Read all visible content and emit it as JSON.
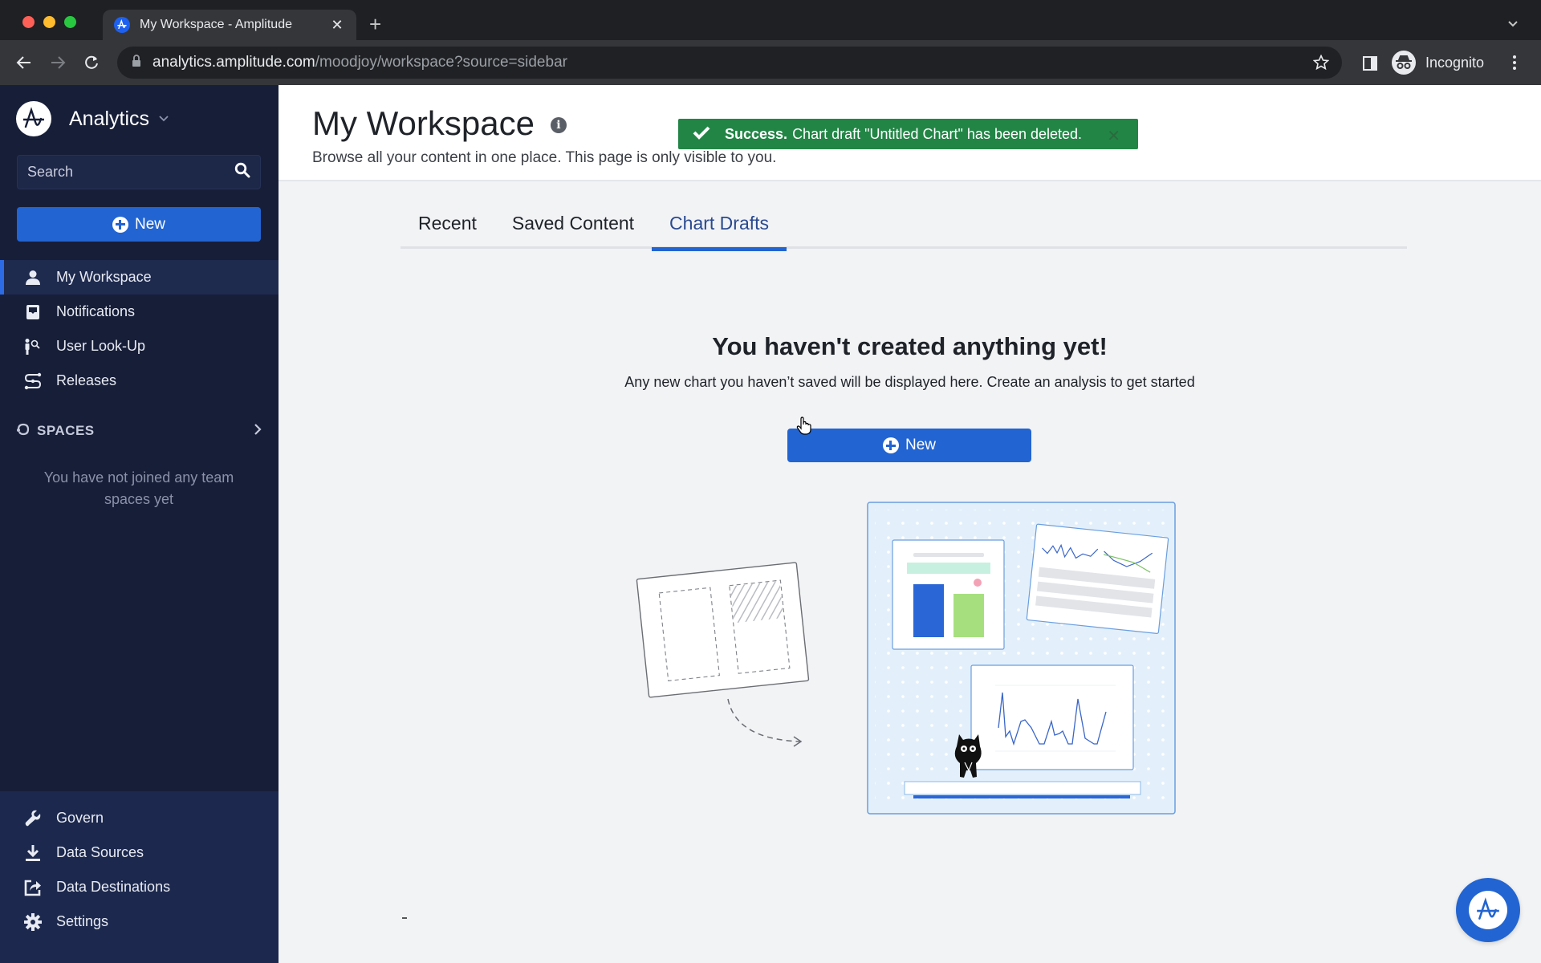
{
  "browser": {
    "tab_title": "My Workspace - Amplitude",
    "url_host": "analytics.amplitude.com",
    "url_path": "/moodjoy/workspace?source=sidebar",
    "profile_label": "Incognito"
  },
  "sidebar": {
    "product_name": "Analytics",
    "search_placeholder": "Search",
    "new_button_label": "New",
    "nav_items": [
      {
        "label": "My Workspace",
        "icon": "person-icon",
        "active": true
      },
      {
        "label": "Notifications",
        "icon": "inbox-icon",
        "active": false
      },
      {
        "label": "User Look-Up",
        "icon": "user-search-icon",
        "active": false
      },
      {
        "label": "Releases",
        "icon": "releases-icon",
        "active": false
      }
    ],
    "spaces": {
      "heading": "SPACES",
      "empty_text": "You have not joined any team spaces yet"
    },
    "bottom_items": [
      {
        "label": "Govern",
        "icon": "wrench-icon"
      },
      {
        "label": "Data Sources",
        "icon": "download-icon"
      },
      {
        "label": "Data Destinations",
        "icon": "share-icon"
      },
      {
        "label": "Settings",
        "icon": "gear-icon"
      }
    ]
  },
  "header": {
    "title": "My Workspace",
    "subtitle": "Browse all your content in one place. This page is only visible to you."
  },
  "toast": {
    "status": "Success.",
    "message": "Chart draft \"Untitled Chart\" has been deleted.",
    "color": "#228546"
  },
  "tabs": [
    {
      "label": "Recent",
      "active": false
    },
    {
      "label": "Saved Content",
      "active": false
    },
    {
      "label": "Chart Drafts",
      "active": true
    }
  ],
  "empty_state": {
    "title": "You haven't created anything yet!",
    "subtitle": "Any new chart you haven’t saved will be displayed here. Create an analysis to get started",
    "button_label": "New"
  },
  "colors": {
    "accent": "#2264d1",
    "sidebar_bg": "#171e38",
    "success": "#228546"
  }
}
